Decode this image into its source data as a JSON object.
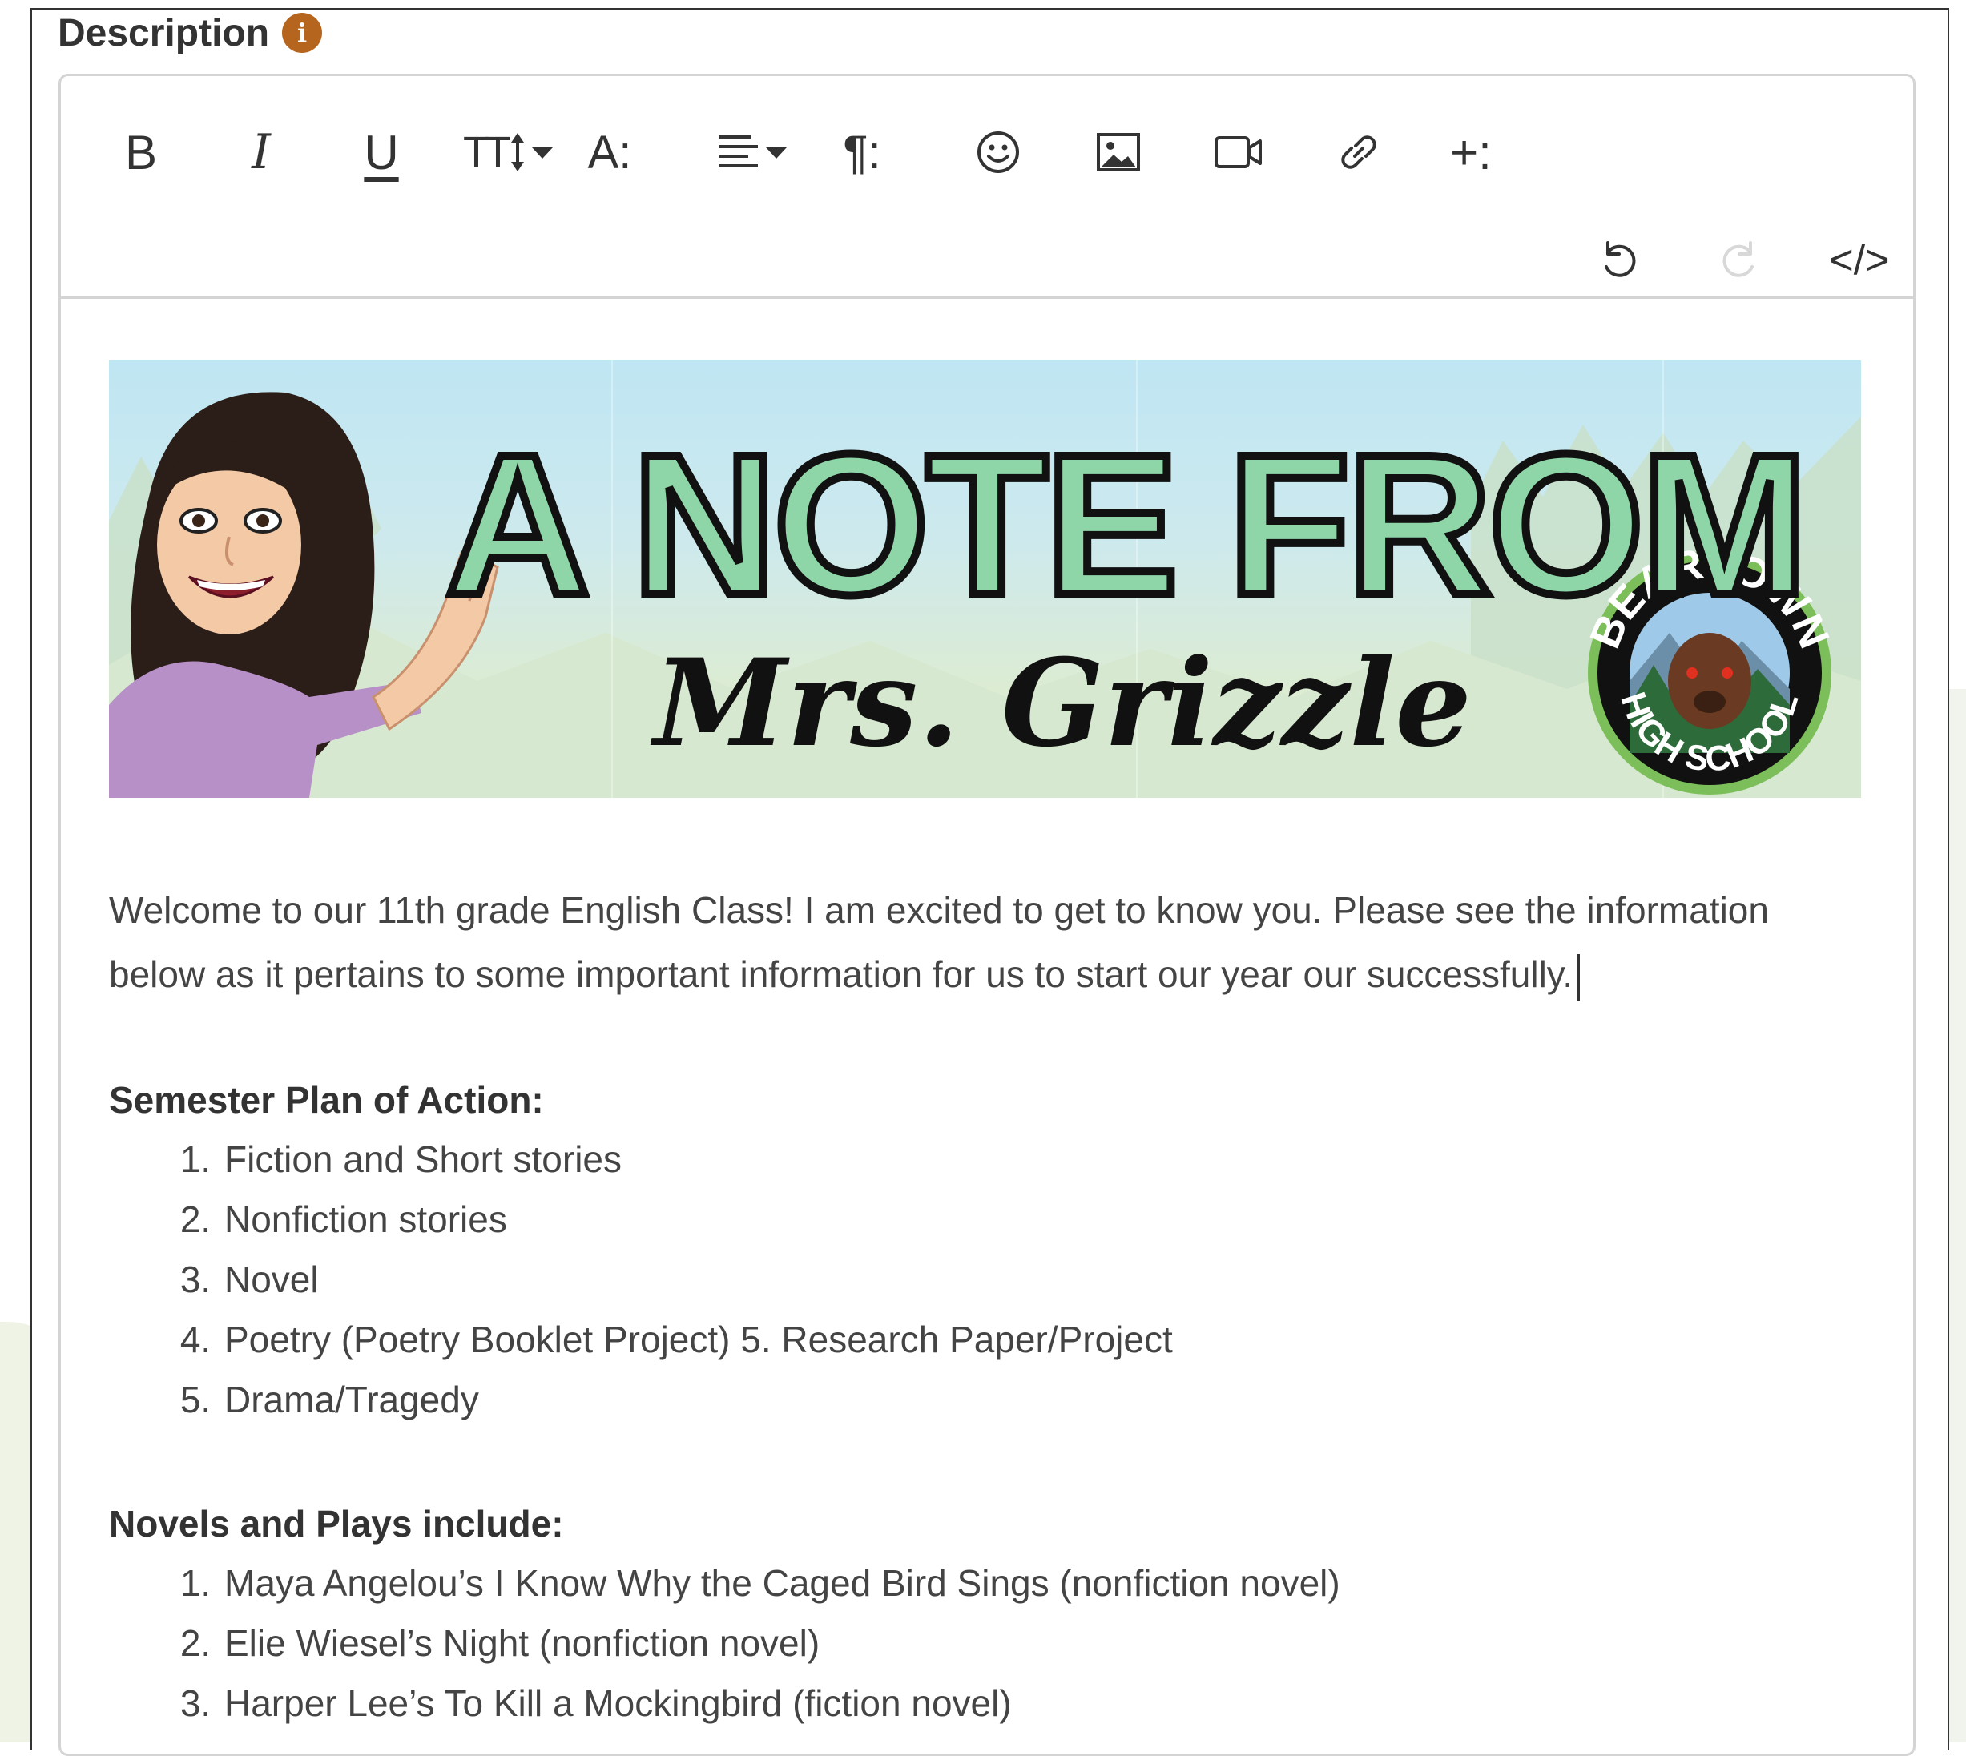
{
  "field": {
    "label": "Description",
    "info_glyph": "i"
  },
  "toolbar": {
    "bold": "B",
    "italic": "I",
    "underline": "U",
    "font_size": "TT",
    "text_color": "A:",
    "paragraph": "¶:",
    "more": "+:",
    "code_view": "</>",
    "icons": [
      "bold-icon",
      "italic-icon",
      "underline-icon",
      "font-size-icon",
      "text-style-icon",
      "align-icon",
      "paragraph-icon",
      "emoji-icon",
      "image-icon",
      "video-icon",
      "link-icon",
      "more-icon",
      "undo-icon",
      "redo-icon",
      "code-icon"
    ]
  },
  "banner": {
    "title": "A NOTE FROM",
    "subtitle": "Mrs. Grizzle",
    "seal_top": "BEARTOWN",
    "seal_bottom": "HIGH SCHOOL"
  },
  "body": {
    "intro": "Welcome to our 11th grade English Class! I am excited to get to know you. Please see the information below as it pertains to some important information for us to start our year our successfully."
  },
  "semester": {
    "heading": "Semester Plan of Action:",
    "items": [
      "Fiction and Short stories",
      "Nonfiction stories",
      "Novel",
      "Poetry (Poetry Booklet Project) 5. Research Paper/Project",
      "Drama/Tragedy"
    ]
  },
  "novels": {
    "heading": "Novels and Plays include:",
    "items": [
      "Maya Angelou’s I Know Why the Caged Bird Sings (nonfiction novel)",
      "Elie Wiesel’s Night (nonfiction novel)",
      "Harper Lee’s To Kill a Mockingbird (fiction novel)"
    ]
  },
  "colors": {
    "info_badge": "#b5651d",
    "banner_title_fill": "#8ed6a8",
    "border": "#d4d4d4"
  }
}
